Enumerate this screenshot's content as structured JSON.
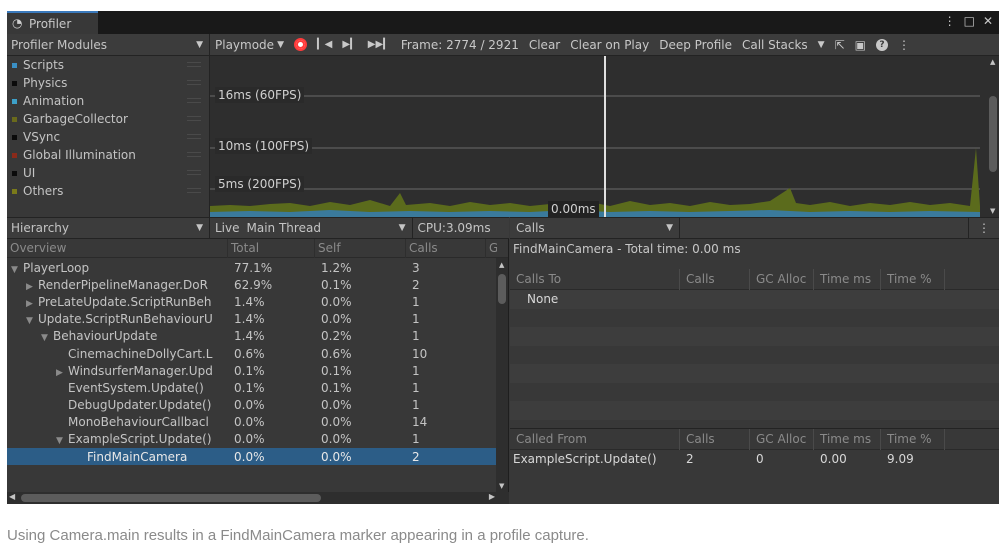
{
  "window": {
    "tab_title": "Profiler",
    "controls": [
      "⋮",
      "□",
      "✕"
    ]
  },
  "toolbar": {
    "modules_label": "Profiler Modules",
    "playmode_label": "Playmode",
    "frame_label": "Frame: 2774 / 2921",
    "clear_label": "Clear",
    "clear_on_play_label": "Clear on Play",
    "deep_profile_label": "Deep Profile",
    "call_stacks_label": "Call Stacks"
  },
  "legend": [
    {
      "name": "Scripts",
      "color": "#3a8fc4"
    },
    {
      "name": "Physics",
      "color": "#0a0a0a"
    },
    {
      "name": "Animation",
      "color": "#3da0c8"
    },
    {
      "name": "GarbageCollector",
      "color": "#6a6a1c"
    },
    {
      "name": "VSync",
      "color": "#0a0a0a"
    },
    {
      "name": "Global Illumination",
      "color": "#8a2a1a"
    },
    {
      "name": "UI",
      "color": "#0a0a0a"
    },
    {
      "name": "Others",
      "color": "#7a7a1a"
    }
  ],
  "graph": {
    "lines": [
      "16ms (60FPS)",
      "10ms (100FPS)",
      "5ms (200FPS)"
    ],
    "cursor_value": "0.00ms"
  },
  "hierarchy_header": {
    "view_label": "Hierarchy",
    "live_label": "Live",
    "thread_label": "Main Thread",
    "cpu_label": "CPU:3.09ms"
  },
  "hierarchy_columns": [
    "Overview",
    "Total",
    "Self",
    "Calls",
    "G"
  ],
  "hierarchy_rows": [
    {
      "indent": 0,
      "arrow": "▼",
      "name": "PlayerLoop",
      "total": "77.1%",
      "self": "1.2%",
      "calls": "3"
    },
    {
      "indent": 1,
      "arrow": "▶",
      "name": "RenderPipelineManager.DoR",
      "total": "62.9%",
      "self": "0.1%",
      "calls": "2"
    },
    {
      "indent": 1,
      "arrow": "▶",
      "name": "PreLateUpdate.ScriptRunBeh",
      "total": "1.4%",
      "self": "0.0%",
      "calls": "1"
    },
    {
      "indent": 1,
      "arrow": "▼",
      "name": "Update.ScriptRunBehaviourU",
      "total": "1.4%",
      "self": "0.0%",
      "calls": "1"
    },
    {
      "indent": 2,
      "arrow": "▼",
      "name": "BehaviourUpdate",
      "total": "1.4%",
      "self": "0.2%",
      "calls": "1"
    },
    {
      "indent": 3,
      "arrow": "",
      "name": "CinemachineDollyCart.L",
      "total": "0.6%",
      "self": "0.6%",
      "calls": "10"
    },
    {
      "indent": 3,
      "arrow": "▶",
      "name": "WindsurferManager.Upd",
      "total": "0.1%",
      "self": "0.1%",
      "calls": "1"
    },
    {
      "indent": 3,
      "arrow": "",
      "name": "EventSystem.Update()",
      "total": "0.1%",
      "self": "0.1%",
      "calls": "1"
    },
    {
      "indent": 3,
      "arrow": "",
      "name": "DebugUpdater.Update()",
      "total": "0.0%",
      "self": "0.0%",
      "calls": "1"
    },
    {
      "indent": 3,
      "arrow": "",
      "name": "MonoBehaviourCallbacl",
      "total": "0.0%",
      "self": "0.0%",
      "calls": "14"
    },
    {
      "indent": 3,
      "arrow": "▼",
      "name": "ExampleScript.Update()",
      "total": "0.0%",
      "self": "0.0%",
      "calls": "1"
    },
    {
      "indent": 4,
      "arrow": "",
      "name": "FindMainCamera",
      "total": "0.0%",
      "self": "0.0%",
      "calls": "2",
      "selected": true
    }
  ],
  "calls_panel": {
    "dropdown_label": "Calls",
    "title": "FindMainCamera - Total time: 0.00 ms",
    "calls_to_columns": [
      "Calls To",
      "Calls",
      "GC Alloc",
      "Time ms",
      "Time %"
    ],
    "calls_to_rows": [
      {
        "name": "None"
      }
    ],
    "called_from_columns": [
      "Called From",
      "Calls",
      "GC Alloc",
      "Time ms",
      "Time %"
    ],
    "called_from_rows": [
      {
        "name": "ExampleScript.Update()",
        "calls": "2",
        "gc": "0",
        "time_ms": "0.00",
        "time_pct": "9.09"
      }
    ]
  },
  "caption": "Using Camera.main results in a FindMainCamera marker appearing in a profile capture."
}
